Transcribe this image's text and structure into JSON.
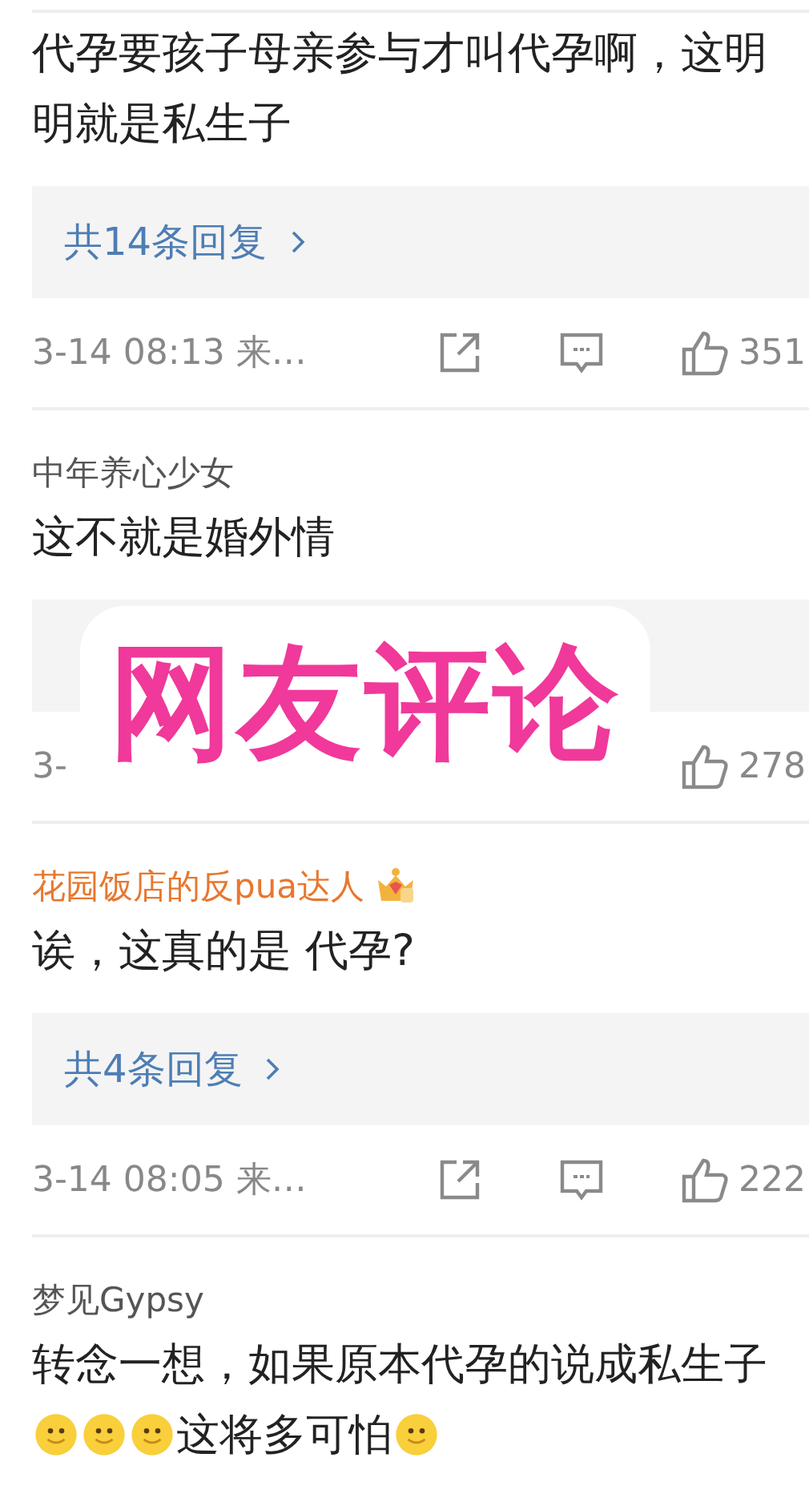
{
  "comments": [
    {
      "segments": [
        {
          "kind": "text",
          "text": "代孕要孩子母亲参与才叫代孕啊，这明明就是私生子"
        }
      ],
      "reply_box": true,
      "replies": "共14条回复",
      "time": "3-14 08:13 来…",
      "share_icon": true,
      "comment_icon": true,
      "likes": "351"
    },
    {
      "user": {
        "name": "中年养心少女",
        "color": "#555555"
      },
      "segments": [
        {
          "kind": "text",
          "text": "这不就是婚外情"
        }
      ],
      "reply_box": true,
      "time": "3-",
      "share_icon": false,
      "comment_icon": false,
      "likes": "278"
    },
    {
      "user": {
        "name": "花园饭店的反pua达人",
        "color": "#e8772e"
      },
      "crown": true,
      "segments": [
        {
          "kind": "text",
          "text": "诶，这真的是 代孕?"
        }
      ],
      "reply_box": true,
      "replies": "共4条回复",
      "time": "3-14 08:05 来…",
      "share_icon": true,
      "comment_icon": true,
      "likes": "222"
    },
    {
      "user": {
        "name": "梦见Gypsy",
        "color": "#555555"
      },
      "segments": [
        {
          "kind": "text",
          "text": "转念一想，如果原本代孕的说成私生子"
        },
        {
          "kind": "emoji"
        },
        {
          "kind": "emoji"
        },
        {
          "kind": "emoji"
        },
        {
          "kind": "text",
          "text": "这将多可怕"
        },
        {
          "kind": "emoji"
        }
      ]
    }
  ],
  "overlay": {
    "text": "网友评论"
  }
}
